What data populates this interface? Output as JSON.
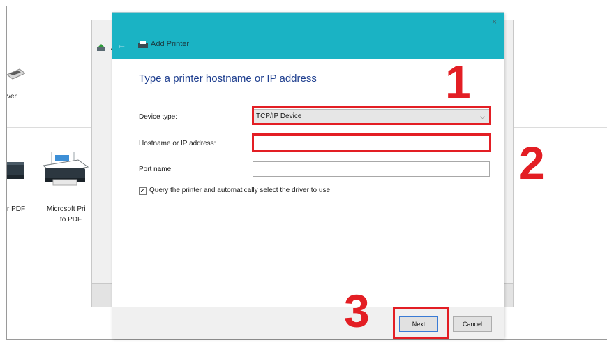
{
  "background": {
    "partial_text_1": "ver",
    "partial_text_2": "r PDF",
    "device_label_line1": "Microsoft Pri",
    "device_label_line2": "to PDF",
    "window_title_fragment": "A"
  },
  "dialog": {
    "title": "Add Printer",
    "close_glyph": "×",
    "back_glyph": "←",
    "heading": "Type a printer hostname or IP address",
    "device_type": {
      "label": "Device type:",
      "value": "TCP/IP Device"
    },
    "hostname": {
      "label": "Hostname or IP address:",
      "value": ""
    },
    "port": {
      "label": "Port name:",
      "value": ""
    },
    "query_checkbox": {
      "checked": true,
      "check_glyph": "✓",
      "label": "Query the printer and automatically select the driver to use"
    },
    "buttons": {
      "next": "Next",
      "cancel": "Cancel"
    }
  },
  "annotations": {
    "step1": "1",
    "step2": "2",
    "step3": "3",
    "color": "#e31e24"
  },
  "colors": {
    "titlebar": "#1ab3c4",
    "heading": "#1f3f8f"
  }
}
